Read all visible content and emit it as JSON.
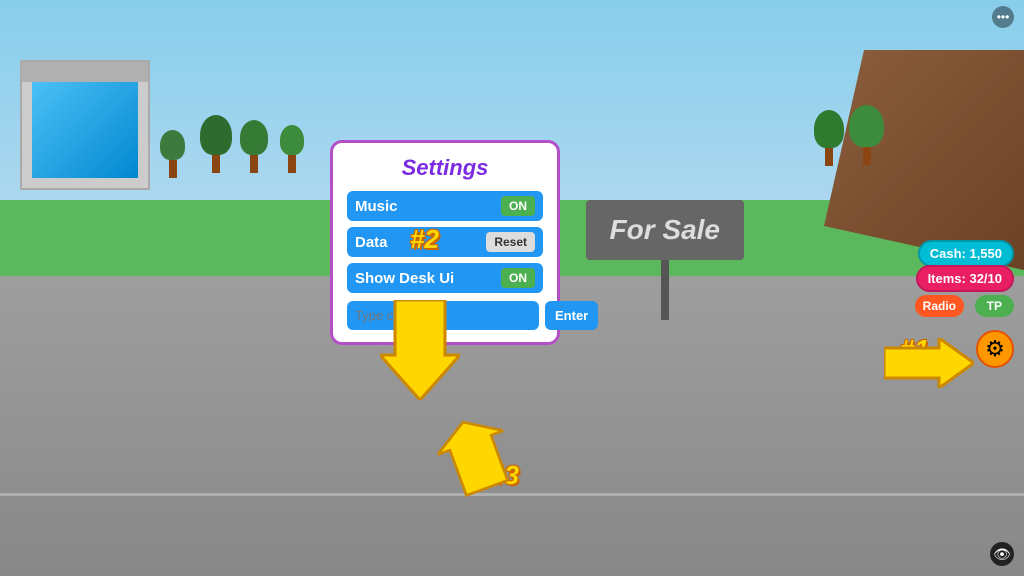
{
  "scene": {
    "background": "game-world"
  },
  "settings_modal": {
    "title": "Settings",
    "rows": [
      {
        "label": "Music",
        "control": "ON",
        "control_type": "toggle"
      },
      {
        "label": "Data",
        "control": "Reset",
        "control_type": "button"
      },
      {
        "label": "Show Desk Ui",
        "control": "ON",
        "control_type": "toggle"
      }
    ],
    "code_input": {
      "placeholder": "Type code here",
      "enter_label": "Enter"
    }
  },
  "hud": {
    "cash": "Cash: 1,550",
    "items": "Items: 32/10",
    "radio_label": "Radio",
    "tp_label": "TP"
  },
  "for_sale_sign": {
    "text": "For Sale"
  },
  "steps": {
    "step1": "#1",
    "step2": "#2",
    "step3": "#3"
  },
  "icons": {
    "gear": "⚙",
    "eye": "👁",
    "more": "•••"
  }
}
